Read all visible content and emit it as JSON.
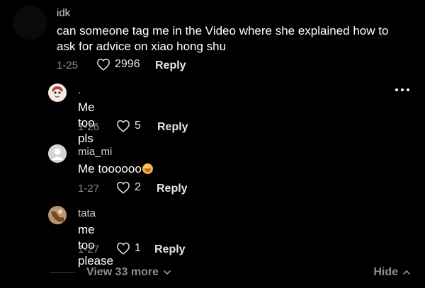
{
  "comments": [
    {
      "username": "idk",
      "text": "can someone tag me in the Video where she explained how to ask for advice on xiao hong shu",
      "date": "1-25",
      "likes": "2996",
      "reply_label": "Reply",
      "avatar_color": "#0a0a0a"
    }
  ],
  "replies": [
    {
      "username": ".",
      "text": "Me too pls",
      "date": "1-26",
      "likes": "5",
      "reply_label": "Reply"
    },
    {
      "username": "mia_mi",
      "text": "Me toooooo",
      "emoji": "face-with-hand-over-mouth",
      "date": "1-27",
      "likes": "2",
      "reply_label": "Reply"
    },
    {
      "username": "tata",
      "text": "me too please",
      "date": "1-27",
      "likes": "1",
      "reply_label": "Reply"
    }
  ],
  "footer": {
    "view_more_label": "View 33 more",
    "hide_label": "Hide"
  },
  "icons": {
    "like": "heart-outline-icon",
    "more": "more-horizontal-icon",
    "view_more": "chevron-down-icon",
    "hide": "chevron-up-icon"
  },
  "colors": {
    "background": "#000000",
    "primary_text": "#ffffff",
    "secondary_text": "#8e8e8e"
  }
}
